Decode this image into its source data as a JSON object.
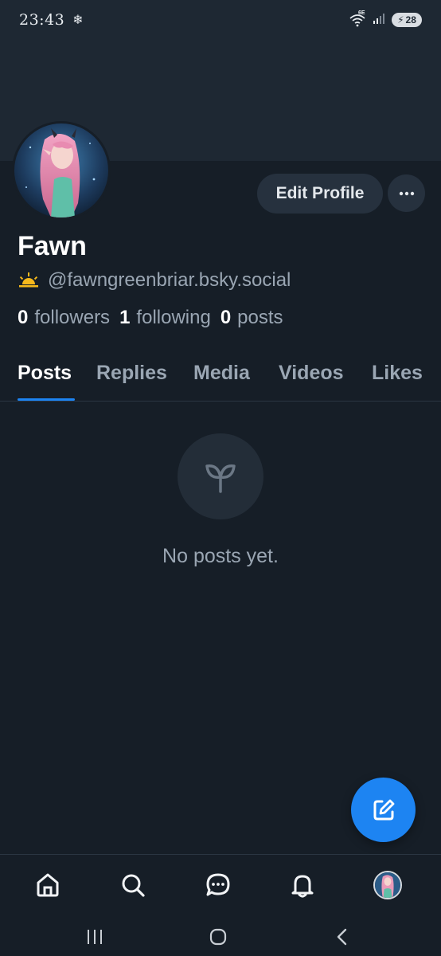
{
  "status_bar": {
    "time": "23:43",
    "weather_icon": "snowflake-icon",
    "battery_level": "28",
    "network_badge": "6E"
  },
  "profile": {
    "display_name": "Fawn",
    "handle": "@fawngreenbriar.bsky.social",
    "handle_emoji": "sunrise-icon",
    "edit_label": "Edit Profile",
    "more_label": "···"
  },
  "stats": [
    {
      "count": "0",
      "label": "followers"
    },
    {
      "count": "1",
      "label": "following"
    },
    {
      "count": "0",
      "label": "posts"
    }
  ],
  "tabs": [
    {
      "label": "Posts",
      "active": true
    },
    {
      "label": "Replies",
      "active": false
    },
    {
      "label": "Media",
      "active": false
    },
    {
      "label": "Videos",
      "active": false
    },
    {
      "label": "Likes",
      "active": false
    }
  ],
  "empty_state": {
    "icon": "sprout-icon",
    "text": "No posts yet."
  },
  "fab": {
    "icon": "compose-icon"
  },
  "bottom_nav": [
    {
      "name": "home",
      "icon": "home-icon"
    },
    {
      "name": "search",
      "icon": "search-icon"
    },
    {
      "name": "chat",
      "icon": "chat-icon"
    },
    {
      "name": "notifications",
      "icon": "bell-icon"
    },
    {
      "name": "profile",
      "icon": "avatar-icon"
    }
  ],
  "system_nav": [
    {
      "name": "recents",
      "icon": "recents-icon"
    },
    {
      "name": "home",
      "icon": "home-circle-icon"
    },
    {
      "name": "back",
      "icon": "back-icon"
    }
  ],
  "colors": {
    "background": "#161e27",
    "banner": "#1e2833",
    "accent": "#1d84f2",
    "muted_text": "#9aa6b3",
    "button_bg": "#26313e"
  }
}
